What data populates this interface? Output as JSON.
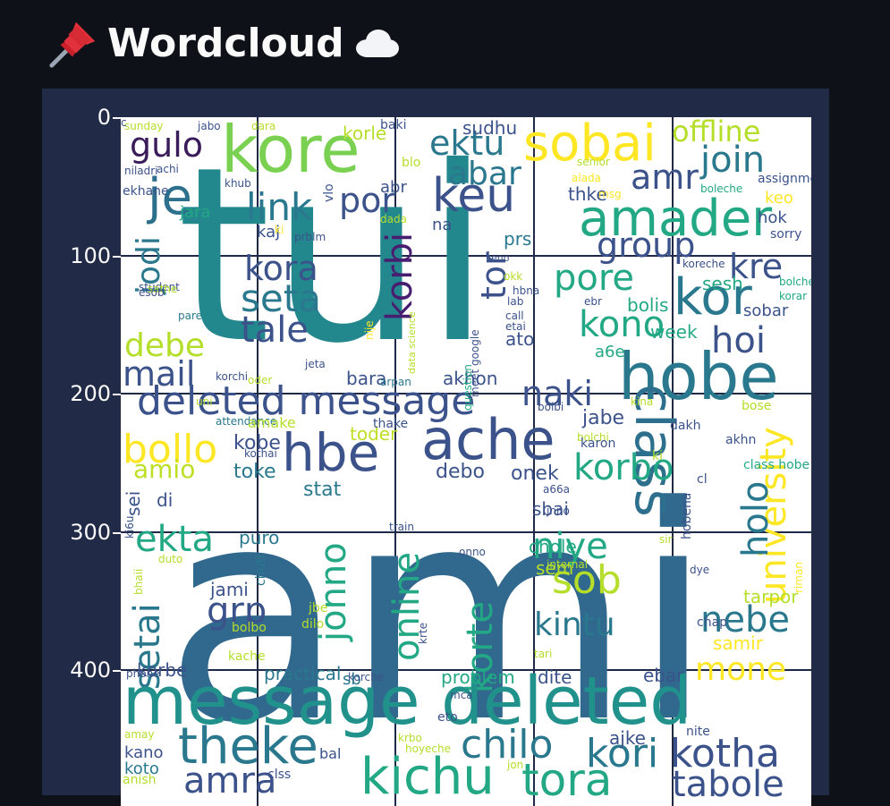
{
  "header": {
    "title": "Wordcloud",
    "left_icon": "pushpin-icon",
    "right_icon": "cloud-icon"
  },
  "chart_data": {
    "type": "wordcloud",
    "y_ticks": [
      "0",
      "100",
      "200",
      "300",
      "400"
    ],
    "background": "#ffffff",
    "grid": true,
    "words": [
      {
        "text": "tui",
        "size": 270,
        "color": "#23888e"
      },
      {
        "text": "ami",
        "size": 330,
        "color": "#31688e"
      },
      {
        "text": "kore",
        "size": 72,
        "color": "#7ad151"
      },
      {
        "text": "sobai",
        "size": 56,
        "color": "#fde725"
      },
      {
        "text": "offline",
        "size": 32,
        "color": "#b5de2b"
      },
      {
        "text": "gulo",
        "size": 38,
        "color": "#3b1c5a"
      },
      {
        "text": "ektu",
        "size": 38,
        "color": "#2a788e"
      },
      {
        "text": "join",
        "size": 40,
        "color": "#2a788e"
      },
      {
        "text": "je",
        "size": 56,
        "color": "#2d708e"
      },
      {
        "text": "link",
        "size": 42,
        "color": "#2a788e"
      },
      {
        "text": "por",
        "size": 38,
        "color": "#3b528b"
      },
      {
        "text": "keu",
        "size": 52,
        "color": "#3b528b"
      },
      {
        "text": "abar",
        "size": 36,
        "color": "#2a788e"
      },
      {
        "text": "amr",
        "size": 38,
        "color": "#3b528b"
      },
      {
        "text": "amader",
        "size": 56,
        "color": "#22a884"
      },
      {
        "text": "group",
        "size": 38,
        "color": "#3b528b"
      },
      {
        "text": "kre",
        "size": 38,
        "color": "#3b528b"
      },
      {
        "text": "jodi",
        "size": 36,
        "color": "#2a788e"
      },
      {
        "text": "kora",
        "size": 38,
        "color": "#3b528b"
      },
      {
        "text": "seta",
        "size": 42,
        "color": "#2a788e"
      },
      {
        "text": "tale",
        "size": 40,
        "color": "#3b528b"
      },
      {
        "text": "korbi",
        "size": 40,
        "color": "#481f70"
      },
      {
        "text": "tor",
        "size": 38,
        "color": "#3b528b"
      },
      {
        "text": "pore",
        "size": 40,
        "color": "#22a884"
      },
      {
        "text": "kor",
        "size": 56,
        "color": "#2a788e"
      },
      {
        "text": "kono",
        "size": 40,
        "color": "#22a884"
      },
      {
        "text": "hoi",
        "size": 40,
        "color": "#3b528b"
      },
      {
        "text": "hobe",
        "size": 72,
        "color": "#2a788e"
      },
      {
        "text": "debe",
        "size": 36,
        "color": "#b5de2b"
      },
      {
        "text": "mail",
        "size": 38,
        "color": "#3b528b"
      },
      {
        "text": "deleted message",
        "size": 44,
        "color": "#3b528b"
      },
      {
        "text": "naki",
        "size": 38,
        "color": "#3b528b"
      },
      {
        "text": "ache",
        "size": 62,
        "color": "#3b528b"
      },
      {
        "text": "hbe",
        "size": 58,
        "color": "#3b528b"
      },
      {
        "text": "bollo",
        "size": 44,
        "color": "#fde725"
      },
      {
        "text": "class",
        "size": 60,
        "color": "#2d708e"
      },
      {
        "text": "korbo",
        "size": 40,
        "color": "#22a884"
      },
      {
        "text": "university",
        "size": 40,
        "color": "#fde725"
      },
      {
        "text": "holo",
        "size": 40,
        "color": "#2a788e"
      },
      {
        "text": "ekta",
        "size": 40,
        "color": "#22a884"
      },
      {
        "text": "niye",
        "size": 40,
        "color": "#22a884"
      },
      {
        "text": "sob",
        "size": 44,
        "color": "#b5de2b"
      },
      {
        "text": "jonno",
        "size": 40,
        "color": "#22a884"
      },
      {
        "text": "online",
        "size": 40,
        "color": "#22a884"
      },
      {
        "text": "korte",
        "size": 40,
        "color": "#22a884"
      },
      {
        "text": "setai",
        "size": 40,
        "color": "#2a788e"
      },
      {
        "text": "grp",
        "size": 40,
        "color": "#3b528b"
      },
      {
        "text": "kintu",
        "size": 36,
        "color": "#2a788e"
      },
      {
        "text": "nebe",
        "size": 40,
        "color": "#2a788e"
      },
      {
        "text": "mone",
        "size": 36,
        "color": "#fde725"
      },
      {
        "text": "message deleted",
        "size": 74,
        "color": "#21918c"
      },
      {
        "text": "theke",
        "size": 56,
        "color": "#2a788e"
      },
      {
        "text": "chilo",
        "size": 44,
        "color": "#2a788e"
      },
      {
        "text": "kori",
        "size": 44,
        "color": "#2a788e"
      },
      {
        "text": "kotha",
        "size": 44,
        "color": "#3b528b"
      },
      {
        "text": "kichu",
        "size": 56,
        "color": "#22a884"
      },
      {
        "text": "tora",
        "size": 50,
        "color": "#22a884"
      },
      {
        "text": "amra",
        "size": 40,
        "color": "#3b528b"
      },
      {
        "text": "tabole",
        "size": 40,
        "color": "#3b528b"
      },
      {
        "text": "amio",
        "size": 28,
        "color": "#bddf26"
      },
      {
        "text": "kobe",
        "size": 22,
        "color": "#3b528b"
      },
      {
        "text": "toke",
        "size": 22,
        "color": "#2a788e"
      },
      {
        "text": "stat",
        "size": 22,
        "color": "#2a788e"
      },
      {
        "text": "debo",
        "size": 22,
        "color": "#3b528b"
      },
      {
        "text": "onek",
        "size": 22,
        "color": "#3b528b"
      },
      {
        "text": "jabe",
        "size": 22,
        "color": "#3b528b"
      },
      {
        "text": "toder",
        "size": 20,
        "color": "#bddf26"
      },
      {
        "text": "akhon",
        "size": 20,
        "color": "#3b528b"
      },
      {
        "text": "bara",
        "size": 20,
        "color": "#3b528b"
      },
      {
        "text": "prs",
        "size": 20,
        "color": "#2a788e"
      },
      {
        "text": "bolis",
        "size": 20,
        "color": "#22a884"
      },
      {
        "text": "week",
        "size": 20,
        "color": "#22a884"
      },
      {
        "text": "sesh",
        "size": 20,
        "color": "#22a884"
      },
      {
        "text": "sobar",
        "size": 18,
        "color": "#3b528b"
      },
      {
        "text": "ato",
        "size": 20,
        "color": "#3b528b"
      },
      {
        "text": "puro",
        "size": 20,
        "color": "#2a788e"
      },
      {
        "text": "jami",
        "size": 20,
        "color": "#3b528b"
      },
      {
        "text": "korbe",
        "size": 20,
        "color": "#3b528b"
      },
      {
        "text": "practical",
        "size": 20,
        "color": "#2a788e"
      },
      {
        "text": "problem",
        "size": 20,
        "color": "#22a884"
      },
      {
        "text": "dite",
        "size": 20,
        "color": "#3b528b"
      },
      {
        "text": "ebar",
        "size": 20,
        "color": "#3b528b"
      },
      {
        "text": "samir",
        "size": 20,
        "color": "#fde725"
      },
      {
        "text": "chole",
        "size": 20,
        "color": "#22a884"
      },
      {
        "text": "sbai",
        "size": 20,
        "color": "#3b528b"
      },
      {
        "text": "sem",
        "size": 20,
        "color": "#b5de2b"
      },
      {
        "text": "tarpor",
        "size": 20,
        "color": "#b5de2b"
      },
      {
        "text": "chap",
        "size": 14,
        "color": "#3b528b"
      },
      {
        "text": "eto",
        "size": 14,
        "color": "#3b528b"
      },
      {
        "text": "ajke",
        "size": 20,
        "color": "#3b528b"
      },
      {
        "text": "nite",
        "size": 14,
        "color": "#3b528b"
      },
      {
        "text": "amay",
        "size": 12,
        "color": "#b5de2b"
      },
      {
        "text": "kano",
        "size": 18,
        "color": "#3b528b"
      },
      {
        "text": "koto",
        "size": 18,
        "color": "#2a788e"
      },
      {
        "text": "anish",
        "size": 14,
        "color": "#b5de2b"
      },
      {
        "text": "bal",
        "size": 16,
        "color": "#3b528b"
      },
      {
        "text": "clss",
        "size": 14,
        "color": "#3b528b"
      },
      {
        "text": "krbo",
        "size": 12,
        "color": "#b5de2b"
      },
      {
        "text": "hoyeche",
        "size": 12,
        "color": "#b5de2b"
      },
      {
        "text": "jon",
        "size": 12,
        "color": "#b5de2b"
      },
      {
        "text": "phone",
        "size": 12,
        "color": "#3b528b"
      },
      {
        "text": "sb",
        "size": 18,
        "color": "#2a788e"
      },
      {
        "text": "korche",
        "size": 12,
        "color": "#3b528b"
      },
      {
        "text": "mca",
        "size": 12,
        "color": "#3b528b"
      },
      {
        "text": "kache",
        "size": 14,
        "color": "#b5de2b"
      },
      {
        "text": "chuti",
        "size": 14,
        "color": "#2a788e"
      },
      {
        "text": "bolbo",
        "size": 14,
        "color": "#b5de2b"
      },
      {
        "text": "dilo",
        "size": 14,
        "color": "#b5de2b"
      },
      {
        "text": "jbe",
        "size": 14,
        "color": "#b5de2b"
      },
      {
        "text": "bhaii",
        "size": 12,
        "color": "#b5de2b"
      },
      {
        "text": "duto",
        "size": 12,
        "color": "#b5de2b"
      },
      {
        "text": "ki6u",
        "size": 12,
        "color": "#3b528b"
      },
      {
        "text": "sei",
        "size": 20,
        "color": "#3b528b"
      },
      {
        "text": "di",
        "size": 20,
        "color": "#3b528b"
      },
      {
        "text": "uni",
        "size": 12,
        "color": "#b5de2b"
      },
      {
        "text": "attendance",
        "size": 12,
        "color": "#2a788e"
      },
      {
        "text": "amake",
        "size": 16,
        "color": "#b5de2b"
      },
      {
        "text": "thake",
        "size": 14,
        "color": "#3b528b"
      },
      {
        "text": "kothai",
        "size": 12,
        "color": "#3b528b"
      },
      {
        "text": "bolbi",
        "size": 12,
        "color": "#3b528b"
      },
      {
        "text": "bolchi",
        "size": 12,
        "color": "#b5de2b"
      },
      {
        "text": "karon",
        "size": 14,
        "color": "#3b528b"
      },
      {
        "text": "dakh",
        "size": 14,
        "color": "#3b528b"
      },
      {
        "text": "ki",
        "size": 14,
        "color": "#b5de2b"
      },
      {
        "text": "bose",
        "size": 14,
        "color": "#b5de2b"
      },
      {
        "text": "akhn",
        "size": 14,
        "color": "#3b528b"
      },
      {
        "text": "class hobe",
        "size": 14,
        "color": "#22a884"
      },
      {
        "text": "cl",
        "size": 14,
        "color": "#3b528b"
      },
      {
        "text": "hobena",
        "size": 14,
        "color": "#3b528b"
      },
      {
        "text": "a66a",
        "size": 12,
        "color": "#3b528b"
      },
      {
        "text": "jnno",
        "size": 12,
        "color": "#3b528b"
      },
      {
        "text": "sir",
        "size": 12,
        "color": "#b5de2b"
      },
      {
        "text": "internal",
        "size": 12,
        "color": "#b5de2b"
      },
      {
        "text": "dye",
        "size": 12,
        "color": "#3b528b"
      },
      {
        "text": "riman",
        "size": 12,
        "color": "#fde725"
      },
      {
        "text": "onno",
        "size": 12,
        "color": "#3b528b"
      },
      {
        "text": "krte",
        "size": 12,
        "color": "#3b528b"
      },
      {
        "text": "train",
        "size": 12,
        "color": "#3b528b"
      },
      {
        "text": "tari",
        "size": 12,
        "color": "#b5de2b"
      },
      {
        "text": "kina",
        "size": 12,
        "color": "#b5de2b"
      },
      {
        "text": "sunday",
        "size": 12,
        "color": "#b5de2b"
      },
      {
        "text": "jabo",
        "size": 12,
        "color": "#3b528b"
      },
      {
        "text": "dara",
        "size": 12,
        "color": "#b5de2b"
      },
      {
        "text": "korle",
        "size": 20,
        "color": "#b5de2b"
      },
      {
        "text": "baki",
        "size": 14,
        "color": "#3b528b"
      },
      {
        "text": "sudhu",
        "size": 20,
        "color": "#3b528b"
      },
      {
        "text": "niladri",
        "size": 12,
        "color": "#3b528b"
      },
      {
        "text": "achi",
        "size": 12,
        "color": "#3b528b"
      },
      {
        "text": "ekhane",
        "size": 14,
        "color": "#3b528b"
      },
      {
        "text": "khub",
        "size": 12,
        "color": "#3b528b"
      },
      {
        "text": "vlo",
        "size": 14,
        "color": "#3b528b"
      },
      {
        "text": "blo",
        "size": 14,
        "color": "#b5de2b"
      },
      {
        "text": "abr",
        "size": 18,
        "color": "#3b528b"
      },
      {
        "text": "senior",
        "size": 12,
        "color": "#b5de2b"
      },
      {
        "text": "alada",
        "size": 12,
        "color": "#fde725"
      },
      {
        "text": "thke",
        "size": 20,
        "color": "#3b528b"
      },
      {
        "text": "msg",
        "size": 12,
        "color": "#fde725"
      },
      {
        "text": "assignment",
        "size": 14,
        "color": "#3b528b"
      },
      {
        "text": "boleche",
        "size": 12,
        "color": "#22a884"
      },
      {
        "text": "keo",
        "size": 18,
        "color": "#fde725"
      },
      {
        "text": "hok",
        "size": 18,
        "color": "#3b528b"
      },
      {
        "text": "sorry",
        "size": 14,
        "color": "#3b528b"
      },
      {
        "text": "jara",
        "size": 18,
        "color": "#22a884"
      },
      {
        "text": "kaj",
        "size": 18,
        "color": "#3b528b"
      },
      {
        "text": "ki",
        "size": 12,
        "color": "#fde725"
      },
      {
        "text": "prblm",
        "size": 12,
        "color": "#3b528b"
      },
      {
        "text": "dada",
        "size": 12,
        "color": "#b5de2b"
      },
      {
        "text": "na",
        "size": 18,
        "color": "#3b528b"
      },
      {
        "text": "student",
        "size": 12,
        "color": "#3b528b"
      },
      {
        "text": "sathe",
        "size": 12,
        "color": "#b5de2b"
      },
      {
        "text": "esob",
        "size": 12,
        "color": "#3b528b"
      },
      {
        "text": "pare",
        "size": 12,
        "color": "#2a788e"
      },
      {
        "text": "nije",
        "size": 12,
        "color": "#fde725"
      },
      {
        "text": "data science",
        "size": 11,
        "color": "#b5de2b"
      },
      {
        "text": "question",
        "size": 12,
        "color": "#22a884"
      },
      {
        "text": "meet google",
        "size": 12,
        "color": "#3b528b"
      },
      {
        "text": "keno",
        "size": 11,
        "color": "#3b528b"
      },
      {
        "text": "okk",
        "size": 12,
        "color": "#b5de2b"
      },
      {
        "text": "hbna",
        "size": 12,
        "color": "#3b528b"
      },
      {
        "text": "lab",
        "size": 12,
        "color": "#3b528b"
      },
      {
        "text": "call",
        "size": 12,
        "color": "#3b528b"
      },
      {
        "text": "etai",
        "size": 12,
        "color": "#3b528b"
      },
      {
        "text": "koreche",
        "size": 12,
        "color": "#3b528b"
      },
      {
        "text": "ebr",
        "size": 12,
        "color": "#3b528b"
      },
      {
        "text": "a6e",
        "size": 18,
        "color": "#22a884"
      },
      {
        "text": "bolche",
        "size": 12,
        "color": "#22a884"
      },
      {
        "text": "korar",
        "size": 12,
        "color": "#22a884"
      },
      {
        "text": "jeta",
        "size": 12,
        "color": "#3b528b"
      },
      {
        "text": "oder",
        "size": 12,
        "color": "#b5de2b"
      },
      {
        "text": "arpan",
        "size": 12,
        "color": "#2a788e"
      },
      {
        "text": "korchi",
        "size": 12,
        "color": "#3b528b"
      },
      {
        "text": "c",
        "size": 12,
        "color": "#3b528b"
      }
    ]
  }
}
